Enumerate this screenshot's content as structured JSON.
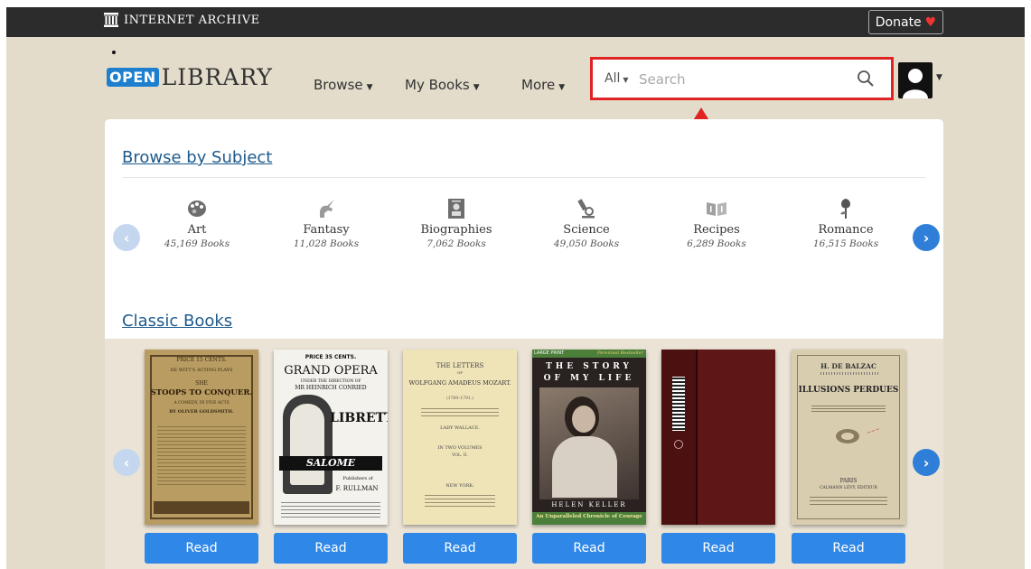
{
  "ia_bar": {
    "title": "INTERNET ARCHIVE",
    "donate_label": "Donate",
    "heart_icon": "heart-icon"
  },
  "header": {
    "logo_open": "OPEN",
    "logo_library": "LIBRARY",
    "nav": [
      {
        "label": "Browse"
      },
      {
        "label": "My Books"
      },
      {
        "label": "More"
      }
    ],
    "search": {
      "scope": "All",
      "placeholder": "Search",
      "value": ""
    },
    "accent_color": "#1f7fcf",
    "highlight_color": "#e02424"
  },
  "browse_by_subject": {
    "title": "Browse by Subject",
    "subjects": [
      {
        "name": "Art",
        "count": "45,169 Books",
        "icon": "palette-icon"
      },
      {
        "name": "Fantasy",
        "count": "11,028 Books",
        "icon": "unicorn-icon"
      },
      {
        "name": "Biographies",
        "count": "7,062 Books",
        "icon": "portrait-icon"
      },
      {
        "name": "Science",
        "count": "49,050 Books",
        "icon": "microscope-icon"
      },
      {
        "name": "Recipes",
        "count": "6,289 Books",
        "icon": "recipe-book-icon"
      },
      {
        "name": "Romance",
        "count": "16,515 Books",
        "icon": "rose-icon"
      }
    ]
  },
  "classic_books": {
    "title": "Classic Books",
    "read_label": "Read",
    "books": [
      {
        "cover_lines": [
          "PRICE 15 CENTS.",
          "DE WITT'S ACTING PLAYS",
          "SHE",
          "STOOPS TO CONQUER.",
          "A COMEDY, IN FIVE ACTS",
          "BY OLIVER GOLDSMITH."
        ]
      },
      {
        "cover_lines": [
          "PRICE 35 CENTS.",
          "GRAND OPERA",
          "UNDER THE DIRECTION OF",
          "MR HEINRICH CONRIED",
          "LIBRETTO",
          "SALOME",
          "Publishers of",
          "F. RULLMAN"
        ]
      },
      {
        "cover_lines": [
          "THE LETTERS",
          "OF",
          "WOLFGANG AMADEUS MOZART.",
          "(1769–1791.)",
          "LADY WALLACE.",
          "IN TWO VOLUMES",
          "VOL. II.",
          "NEW YORK:"
        ]
      },
      {
        "cover_lines": [
          "LARGE PRINT",
          "Perennial Bestseller",
          "THE STORY",
          "OF MY LIFE",
          "HELEN KELLER",
          "An Unparalleled Chronicle of Courage"
        ]
      },
      {
        "cover_lines": []
      },
      {
        "cover_lines": [
          "H. DE BALZAC",
          "ILLUSIONS PERDUES",
          "PARIS",
          "CALMANN LÉVY, ÉDITEUR"
        ]
      }
    ]
  }
}
